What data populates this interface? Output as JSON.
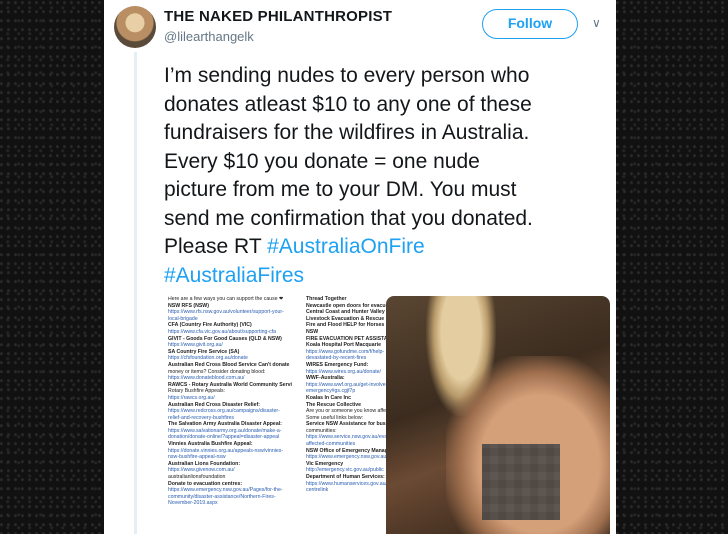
{
  "header": {
    "display_name": "THE NAKED PHILANTHROPIST",
    "handle": "@lilearthangelk",
    "follow_label": "Follow",
    "menu_icon": "chevron-down-icon"
  },
  "tweet": {
    "text_lines": [
      "I’m sending nudes to every person who",
      "donates atleast $10 to any one of these",
      "fundraisers for the wildfires in Australia.",
      "Every $10 you donate = one nude",
      "picture from me to your DM. You must",
      "send me confirmation that you donated."
    ],
    "last_line_prefix": "Please RT ",
    "hashtag_1": "#AustraliaOnFire",
    "hashtag_2": "#AustraliaFires"
  },
  "attachment": {
    "left_column": [
      "Here are a few ways you can support the cause ❤",
      "NSW RFS (NSW)",
      "https://www.rfs.nsw.gov.au/volunteer/support-your-",
      "local-brigade",
      "CFA (Country Fire Authority) (VIC)",
      "https://www.cfa.vic.gov.au/about/supporting-cfa",
      "GIVIT - Goods For Good Causes (QLD & NSW)",
      "https://www.givit.org.au/",
      "SA Country Fire Service (SA)",
      "https://cfsfoundation.org.au/donate",
      "",
      "Australian Red Cross Blood Service Can't donate",
      "money or items? Consider donating blood:",
      "https://www.donateblood.com.au/",
      "RAWCS - Rotary Australia World Community Service",
      "Rotary Bushfire Appeals:",
      "https://rawcs.org.au/",
      "Australian Red Cross Disaster Relief:",
      "https://www.redcross.org.au/campaigns/disaster-",
      "relief-and-recovery-bushfires",
      "The Salvation Army Australia Disaster Appeal:",
      "https://www.salvationarmy.org.au/donate/make-a-",
      "donation/donate-online/?appeal=disaster-appeal",
      "Vinnies Australia Bushfire Appeal:",
      "https://donate.vinnies.org.au/appeals-nsw/vinnies-",
      "nsw-bushfire-appeal-nsw",
      "Australian Lions Foundation:",
      "https://www.givenow.com.au/",
      "australianlionsfoundation",
      "Donate to evacuation centres:",
      "https://www.emergency.nsw.gov.au/Pages/for-the-",
      "community/disaster-assistance/Northern-Fires-",
      "November-2019.aspx"
    ],
    "right_column": [
      "Thread Together",
      "Newcastle open doors for evacuees",
      "Central Coast and Hunter Valley",
      "Livestock Evacuation & Rescue",
      "Fire and Flood HELP for Horses",
      "NSW",
      "FIRE EVACUATION PET ASSISTANCE",
      "",
      "Koala Hospital Port Macquarie",
      "https://www.gofundme.com/f/help-",
      "devastated-by-recent-fires",
      "WIRES Emergency Fund:",
      "https://www.wires.org.au/donate/",
      "WWF-Australia:",
      "https://www.wwf.org.au/get-involved/",
      "emergency#gs.cgjf7p",
      "Koalas In Care Inc",
      "The Rescue Collective",
      "",
      "Are you or someone you know affected?",
      "Some useful links below:",
      "Service NSW Assistance for bushfire",
      "communities:",
      "https://www.service.nsw.gov.au/evac",
      "affected-communities",
      "NSW Office of Emergency Management",
      "https://www.emergency.nsw.gov.au/",
      "Vic Emergency",
      "http://emergency.vic.gov.au/public",
      "Department of Human Services:",
      "https://www.humanservices.gov.au/",
      "centrelink"
    ]
  }
}
